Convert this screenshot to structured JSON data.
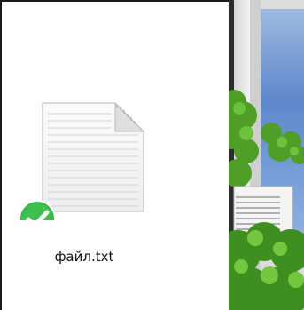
{
  "file": {
    "name": "файл.txt",
    "icon": "text-document-icon",
    "status_icon": "sync-checkmark-icon",
    "status": "synced"
  },
  "desktop": {
    "background": "nature-window-wallpaper"
  },
  "colors": {
    "status_green": "#39b54a",
    "sky_blue": "#5e87cc",
    "foliage_green": "#4e9e28"
  }
}
